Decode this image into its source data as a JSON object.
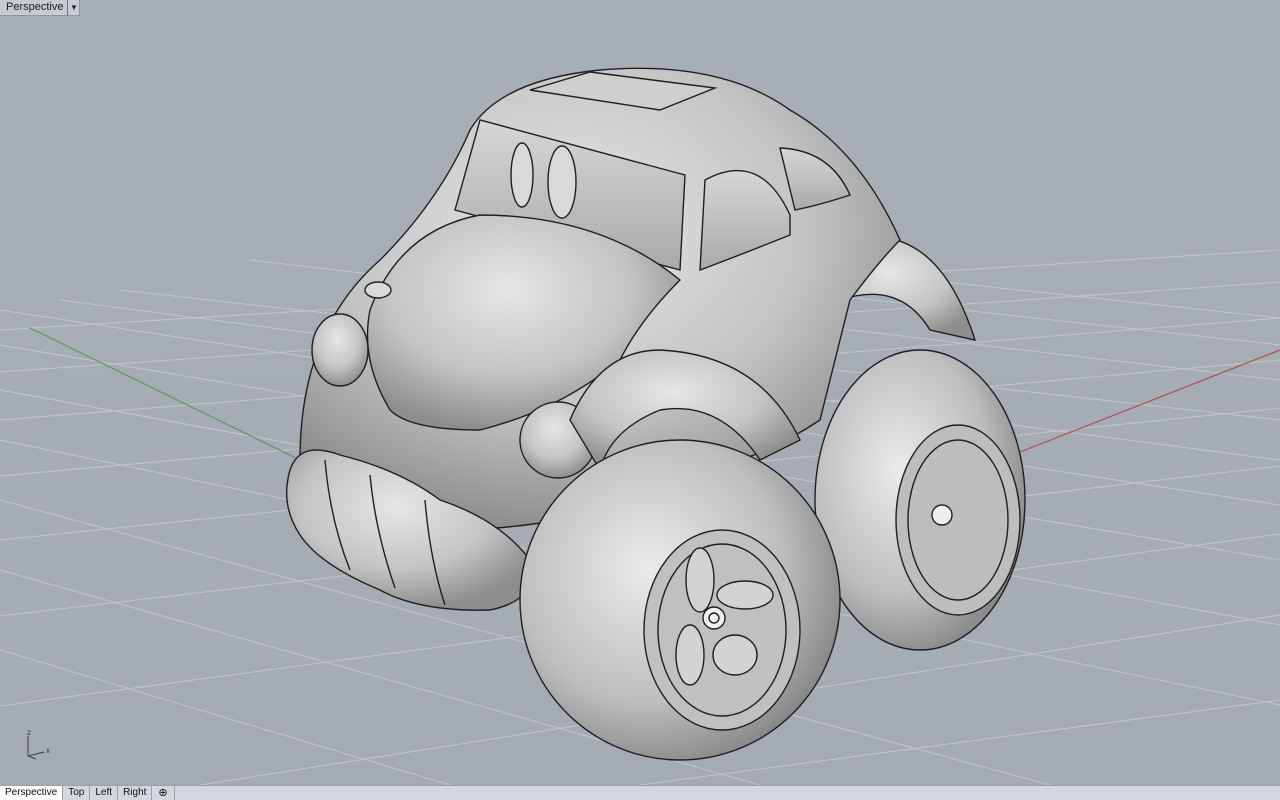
{
  "viewport": {
    "title": "Perspective",
    "dropdown_icon": "triangle-down-icon"
  },
  "axes": {
    "z_label": "z",
    "x_label": "x"
  },
  "tabs": [
    {
      "label": "Perspective",
      "active": true
    },
    {
      "label": "Top",
      "active": false
    },
    {
      "label": "Left",
      "active": false
    },
    {
      "label": "Right",
      "active": false
    }
  ],
  "add_tab_icon": "crosshair-plus-icon",
  "colors": {
    "background": "#a7adb5",
    "grid": "#bfc4ca",
    "x_axis": "#b84a4a",
    "y_axis": "#5a9a5a",
    "model": "#c9c9c9"
  }
}
